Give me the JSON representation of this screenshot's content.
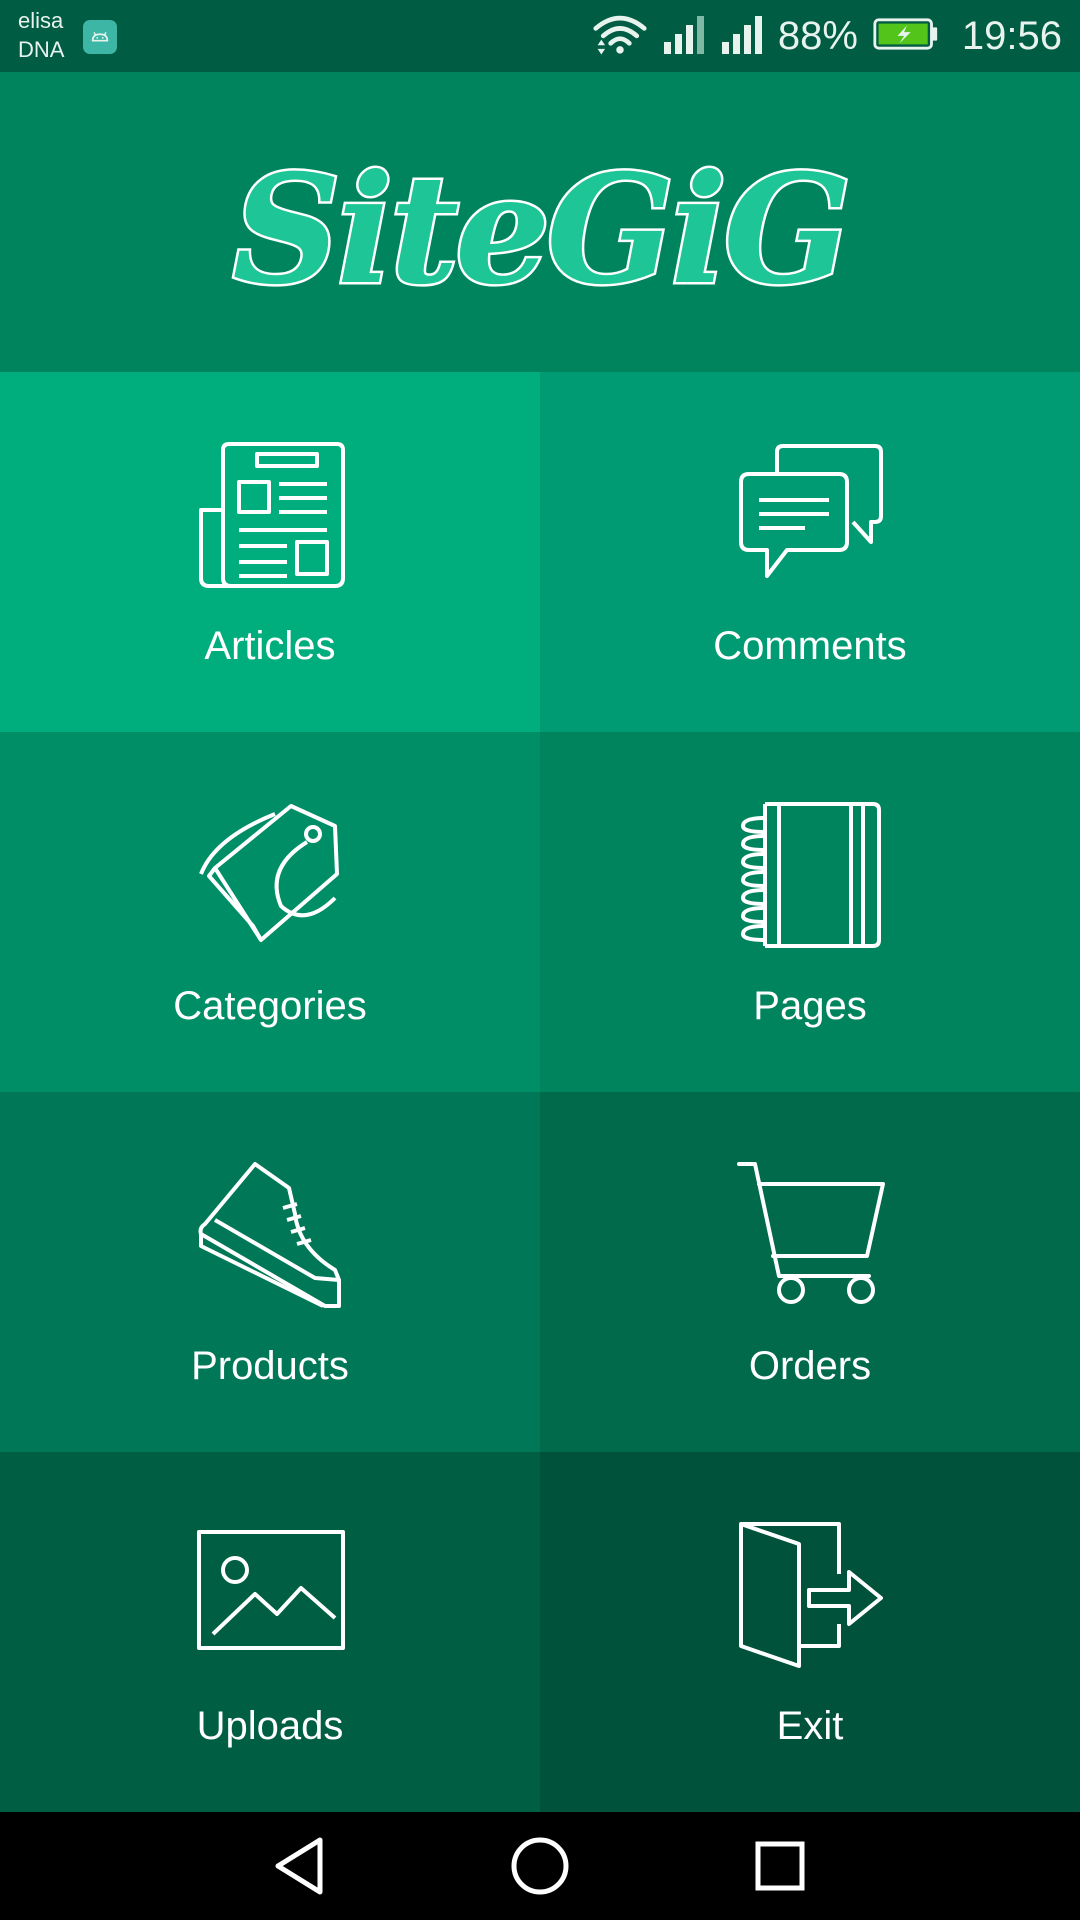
{
  "status_bar": {
    "carrier_line1": "elisa",
    "carrier_line2": "DNA",
    "battery_percent": "88%",
    "time": "19:56",
    "icons": [
      "android-notification-icon",
      "wifi-icon",
      "signal-icon",
      "signal-icon",
      "battery-charging-icon"
    ]
  },
  "header": {
    "logo_text": "SiteGiG"
  },
  "menu": {
    "articles": {
      "label": "Articles",
      "icon": "newspaper-icon"
    },
    "comments": {
      "label": "Comments",
      "icon": "chat-bubbles-icon"
    },
    "categories": {
      "label": "Categories",
      "icon": "tag-icon"
    },
    "pages": {
      "label": "Pages",
      "icon": "notebook-icon"
    },
    "products": {
      "label": "Products",
      "icon": "sneaker-icon"
    },
    "orders": {
      "label": "Orders",
      "icon": "shopping-cart-icon"
    },
    "uploads": {
      "label": "Uploads",
      "icon": "image-icon"
    },
    "exit": {
      "label": "Exit",
      "icon": "exit-door-icon"
    }
  },
  "nav_bar": {
    "buttons": [
      "back-icon",
      "home-icon",
      "recents-icon"
    ]
  },
  "colors": {
    "status_bar": "#005c42",
    "header": "#00845e",
    "articles": "#00ad7d",
    "comments": "#009b72",
    "categories": "#008e67",
    "pages": "#00845e",
    "products": "#007756",
    "orders": "#006a4b",
    "uploads": "#005e42",
    "exit": "#00523a",
    "logo_fill": "#1ec596"
  }
}
